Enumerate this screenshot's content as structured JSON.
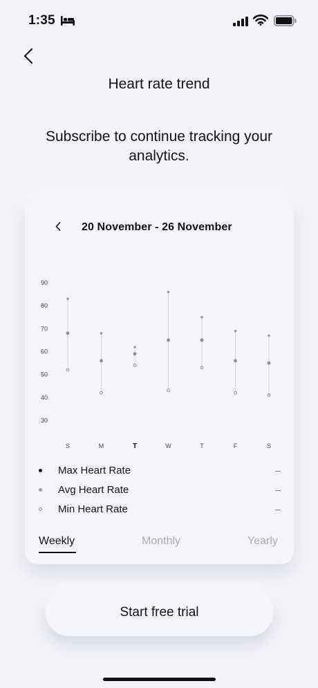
{
  "status_bar": {
    "time": "1:35"
  },
  "header": {
    "title": "Heart rate trend"
  },
  "subtitle": "Subscribe to continue tracking your analytics.",
  "card": {
    "week_range": "20 November - 26 November",
    "legend": [
      {
        "key": "max",
        "label": "Max Heart Rate",
        "value": "–"
      },
      {
        "key": "avg",
        "label": "Avg Heart Rate",
        "value": "–"
      },
      {
        "key": "min",
        "label": "Min Heart Rate",
        "value": "–"
      }
    ],
    "tabs": [
      {
        "label": "Weekly",
        "active": true
      },
      {
        "label": "Monthly",
        "active": false
      },
      {
        "label": "Yearly",
        "active": false
      }
    ]
  },
  "cta": {
    "label": "Start free trial"
  },
  "colors": {
    "background": "#f3f4f9",
    "max_dot": "#9a9a9a",
    "range_line": "#d6d6d6",
    "text": "#111111"
  },
  "chart_data": {
    "type": "scatter",
    "categories": [
      "S",
      "M",
      "T",
      "W",
      "T",
      "F",
      "S"
    ],
    "highlight_index": 2,
    "yticks": [
      30,
      40,
      50,
      60,
      70,
      80,
      90
    ],
    "ylim": [
      30,
      90
    ],
    "grid": false,
    "series": [
      {
        "name": "Max Heart Rate",
        "values": [
          83,
          68,
          62,
          86,
          75,
          69,
          67
        ]
      },
      {
        "name": "Avg Heart Rate",
        "values": [
          68,
          56,
          59,
          65,
          65,
          56,
          55
        ]
      },
      {
        "name": "Min Heart Rate",
        "values": [
          52,
          42,
          54,
          43,
          53,
          42,
          41
        ]
      }
    ]
  }
}
